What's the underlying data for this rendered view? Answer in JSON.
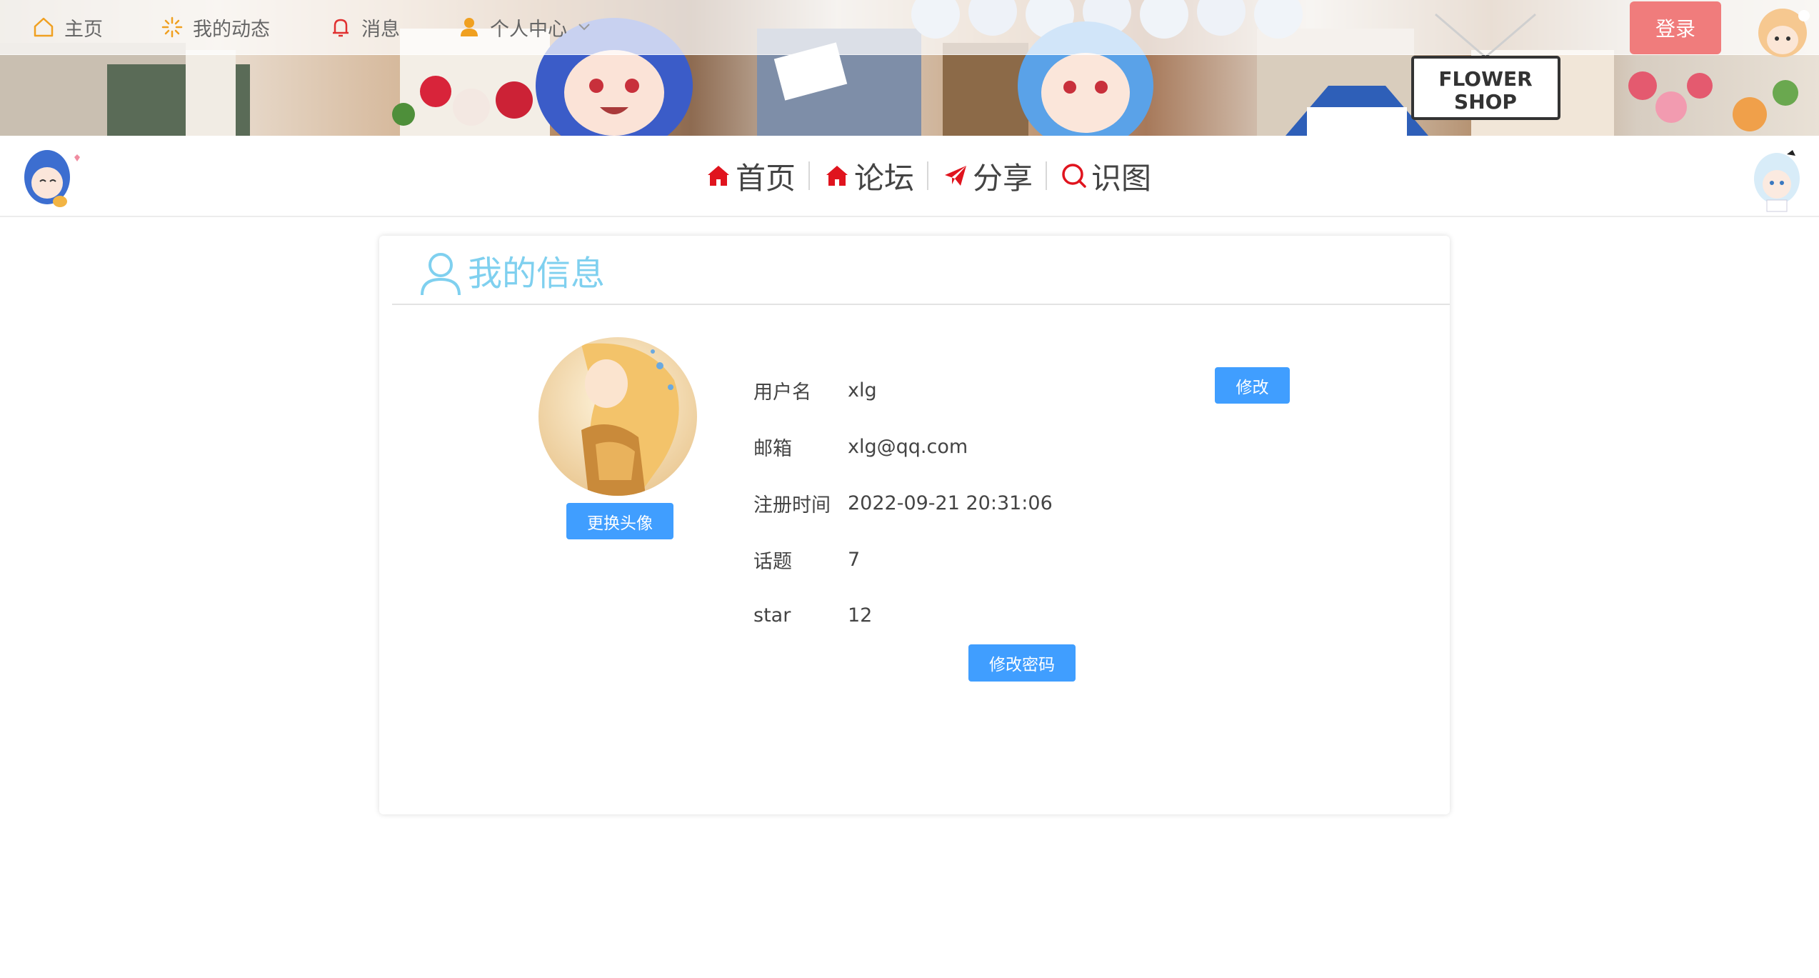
{
  "topnav": {
    "items": [
      {
        "label": "主页",
        "icon": "home-outline-icon"
      },
      {
        "label": "我的动态",
        "icon": "sparkle-icon"
      },
      {
        "label": "消息",
        "icon": "bell-icon"
      },
      {
        "label": "个人中心",
        "icon": "user-icon"
      }
    ],
    "login_label": "登录"
  },
  "banner": {
    "sign_line1": "FLOWER",
    "sign_line2": "SHOP"
  },
  "mainnav": {
    "items": [
      {
        "label": "首页",
        "icon": "home-icon"
      },
      {
        "label": "论坛",
        "icon": "home-icon"
      },
      {
        "label": "分享",
        "icon": "paper-plane-icon"
      },
      {
        "label": "识图",
        "icon": "search-icon"
      }
    ]
  },
  "profile": {
    "title": "我的信息",
    "change_avatar_label": "更换头像",
    "edit_label": "修改",
    "change_password_label": "修改密码",
    "fields": [
      {
        "label": "用户名",
        "value": "xlg"
      },
      {
        "label": "邮箱",
        "value": "xlg@qq.com"
      },
      {
        "label": "注册时间",
        "value": "2022-09-21 20:31:06"
      },
      {
        "label": "话题",
        "value": "7"
      },
      {
        "label": "star",
        "value": "12"
      }
    ]
  },
  "colors": {
    "accent_blue": "#409eff",
    "title_blue": "#7fd0ef",
    "login_red": "#f07c7c",
    "nav_icon_red": "#e0141e"
  }
}
